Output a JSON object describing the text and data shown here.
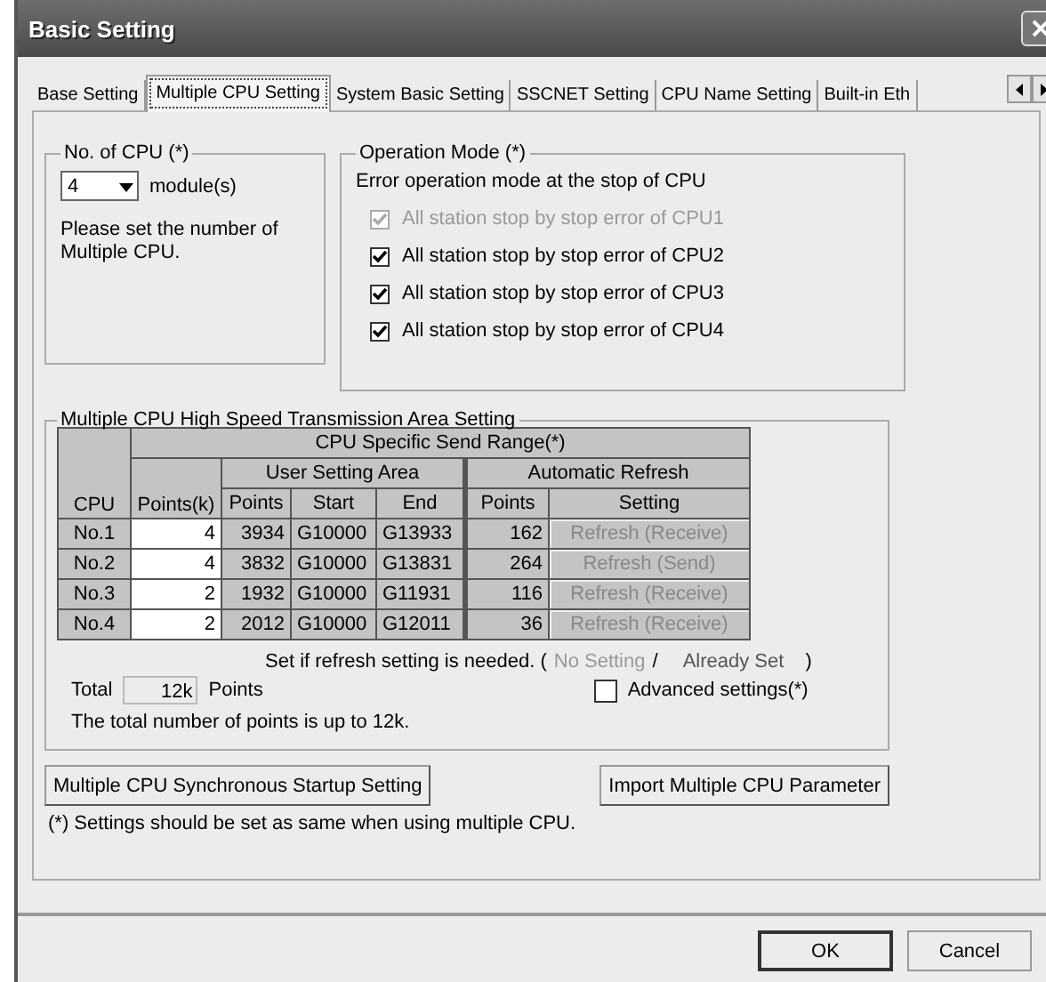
{
  "window": {
    "title": "Basic Setting"
  },
  "tabs": [
    {
      "label": "Base Setting",
      "selected": false
    },
    {
      "label": "Multiple CPU Setting",
      "selected": true
    },
    {
      "label": "System Basic Setting",
      "selected": false
    },
    {
      "label": "SSCNET Setting",
      "selected": false
    },
    {
      "label": "CPU Name Setting",
      "selected": false
    },
    {
      "label": "Built-in Eth",
      "selected": false
    }
  ],
  "cpu_count": {
    "label": "No. of CPU (*)",
    "value": "4",
    "unit": "module(s)",
    "note": "Please set the number of Multiple CPU."
  },
  "operation_mode": {
    "label": "Operation Mode (*)",
    "caption": "Error operation mode at the stop of CPU",
    "options": [
      {
        "label": "All station stop by stop error of CPU1",
        "checked": true,
        "disabled": true
      },
      {
        "label": "All station stop by stop error of CPU2",
        "checked": true,
        "disabled": false
      },
      {
        "label": "All station stop by stop error of CPU3",
        "checked": true,
        "disabled": false
      },
      {
        "label": "All station stop by stop error of CPU4",
        "checked": true,
        "disabled": false
      }
    ]
  },
  "transmission": {
    "label": "Multiple CPU High Speed Transmission Area Setting",
    "table": {
      "header_cpu": "CPU",
      "header_range": "CPU Specific Send Range(*)",
      "header_points_k": "Points(k)",
      "header_user_area": "User Setting Area",
      "header_auto_refresh": "Automatic Refresh",
      "header_points": "Points",
      "header_start": "Start",
      "header_end": "End",
      "header_refresh_points": "Points",
      "header_setting": "Setting",
      "rows": [
        {
          "cpu": "No.1",
          "points_k": "4",
          "points": "3934",
          "start": "G10000",
          "end": "G13933",
          "refresh_points": "162",
          "setting": "Refresh (Receive)"
        },
        {
          "cpu": "No.2",
          "points_k": "4",
          "points": "3832",
          "start": "G10000",
          "end": "G13831",
          "refresh_points": "264",
          "setting": "Refresh (Send)"
        },
        {
          "cpu": "No.3",
          "points_k": "2",
          "points": "1932",
          "start": "G10000",
          "end": "G11931",
          "refresh_points": "116",
          "setting": "Refresh (Receive)"
        },
        {
          "cpu": "No.4",
          "points_k": "2",
          "points": "2012",
          "start": "G10000",
          "end": "G12011",
          "refresh_points": "36",
          "setting": "Refresh (Receive)"
        }
      ]
    },
    "legend": {
      "prefix": "Set if refresh setting is needed. (",
      "no_setting": "No Setting",
      "separator": "/",
      "already_set": "Already Set",
      "suffix": ")"
    },
    "total": {
      "label": "Total",
      "value": "12k",
      "unit": "Points"
    },
    "advanced": {
      "label": "Advanced settings(*)",
      "checked": false
    },
    "note": "The total number of points is up to 12k."
  },
  "buttons": [
    "Multiple CPU Synchronous Startup Setting",
    "Import Multiple CPU Parameter"
  ],
  "footnote": "(*) Settings should be set as same when using multiple CPU.",
  "dialog_buttons": [
    "OK",
    "Cancel"
  ]
}
